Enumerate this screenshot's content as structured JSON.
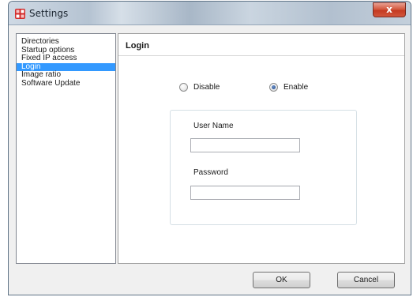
{
  "window": {
    "title": "Settings",
    "close_label": "x",
    "icons": {
      "app": "settings-app-icon",
      "close": "close-icon"
    },
    "colors": {
      "selection": "#3399ff",
      "close_button": "#c43b22"
    }
  },
  "sidebar": {
    "items": [
      {
        "label": "Directories",
        "selected": false
      },
      {
        "label": "Startup options",
        "selected": false
      },
      {
        "label": "Fixed IP access",
        "selected": false
      },
      {
        "label": "Login",
        "selected": true
      },
      {
        "label": "Image ratio",
        "selected": false
      },
      {
        "label": "Software Update",
        "selected": false
      }
    ]
  },
  "login": {
    "header": "Login",
    "mode": {
      "disable_label": "Disable",
      "enable_label": "Enable",
      "selected": "Enable"
    },
    "username": {
      "label": "User Name",
      "value": ""
    },
    "password": {
      "label": "Password",
      "value": ""
    }
  },
  "buttons": {
    "ok": "OK",
    "cancel": "Cancel"
  }
}
